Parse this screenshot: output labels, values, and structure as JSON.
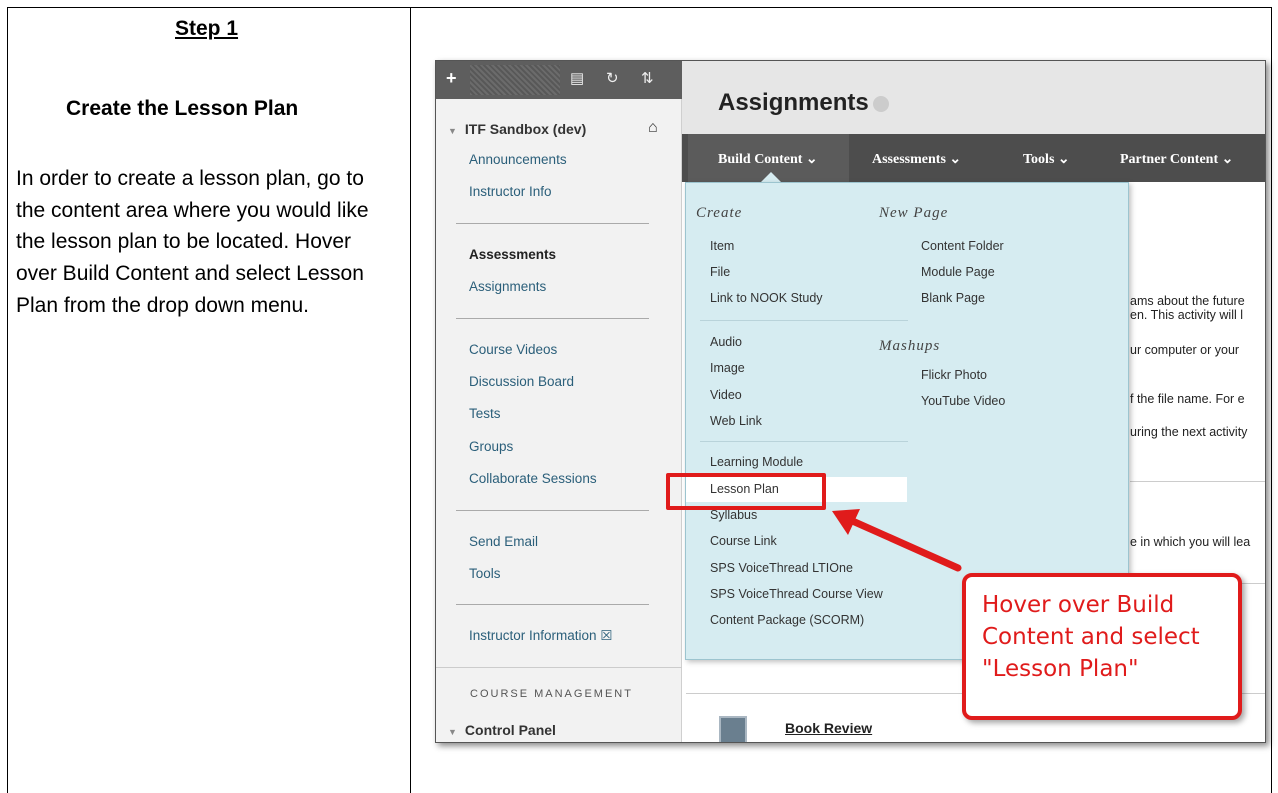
{
  "document": {
    "step_title": "Step 1",
    "section_title": "Create the Lesson Plan",
    "instructions": "In order to create a lesson plan, go to the content area where you would like the lesson plan to be located. Hover over Build Content and select Lesson Plan from the drop down menu."
  },
  "course_menu": {
    "course_title": "ITF Sandbox (dev)",
    "items": [
      "Announcements",
      "Instructor Info",
      "Assessments",
      "Assignments",
      "Course Videos",
      "Discussion Board",
      "Tests",
      "Groups",
      "Collaborate Sessions",
      "Send Email",
      "Tools",
      "Instructor Information"
    ],
    "section_label": "COURSE MANAGEMENT",
    "control_panel": "Control Panel"
  },
  "page": {
    "title": "Assignments",
    "toolbar": [
      "Build Content",
      "Assessments",
      "Tools",
      "Partner Content"
    ],
    "background_text": [
      "ams about the future",
      "en. This activity will l",
      "ur computer or your",
      "f the file name. For e",
      "uring the next activity",
      "e in which you will lea"
    ],
    "book_review": "Book Review"
  },
  "dropdown": {
    "create_heading": "Create",
    "create_items_1": [
      "Item",
      "File",
      "Link to NOOK Study"
    ],
    "create_items_2": [
      "Audio",
      "Image",
      "Video",
      "Web Link"
    ],
    "create_items_3": [
      "Learning Module",
      "Lesson Plan",
      "Syllabus",
      "Course Link",
      "SPS VoiceThread LTIOne",
      "SPS VoiceThread Course View",
      "Content Package (SCORM)"
    ],
    "new_page_heading": "New Page",
    "new_page_items": [
      "Content Folder",
      "Module Page",
      "Blank Page"
    ],
    "mashups_heading": "Mashups",
    "mashups_items": [
      "Flickr Photo",
      "YouTube Video"
    ]
  },
  "callout": {
    "text": "Hover over Build Content and select \"Lesson Plan\""
  },
  "colors": {
    "highlight_red": "#e01b1b",
    "dropdown_bg": "#d6ecf1",
    "link_color": "#2b5f7a"
  }
}
